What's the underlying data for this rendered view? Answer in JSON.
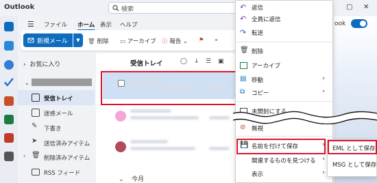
{
  "app": {
    "title": "Outlook"
  },
  "search": {
    "placeholder": "検索"
  },
  "ribbon": {
    "tabs": [
      "ファイル",
      "ホーム",
      "表示",
      "ヘルプ"
    ],
    "active_tab": "ホーム"
  },
  "toolbar": {
    "new_mail": "新規メール",
    "delete": "削除",
    "archive": "アーカイブ",
    "report": "報告"
  },
  "toggle": {
    "label": "ook"
  },
  "folders": {
    "favorites": "お気に入り",
    "items": [
      {
        "label": "受信トレイ",
        "icon": "inbox-icon",
        "selected": true
      },
      {
        "label": "迷惑メール",
        "icon": "junk-icon"
      },
      {
        "label": "下書き",
        "icon": "draft-icon"
      },
      {
        "label": "送信済みアイテム",
        "icon": "sent-icon"
      },
      {
        "label": "削除済みアイテム",
        "icon": "trash-icon"
      },
      {
        "label": "RSS フィード",
        "icon": "folder-icon"
      }
    ]
  },
  "maillist": {
    "title": "受信トレイ",
    "group_today": "今月"
  },
  "context_menu": {
    "items": [
      {
        "label": "返信",
        "icon": "reply-icon"
      },
      {
        "label": "全員に返信",
        "icon": "reply-all-icon"
      },
      {
        "label": "転送",
        "icon": "forward-icon"
      },
      {
        "label": "削除",
        "icon": "delete-icon"
      },
      {
        "label": "アーカイブ",
        "icon": "archive-icon"
      },
      {
        "label": "移動",
        "icon": "move-icon",
        "submenu": true
      },
      {
        "label": "コピー",
        "icon": "copy-icon",
        "submenu": true
      },
      {
        "label": "未開封にする",
        "icon": "unread-icon"
      },
      {
        "label": "無視",
        "icon": "ignore-icon"
      },
      {
        "label": "名前を付けて保存",
        "icon": "save-icon",
        "submenu": true
      },
      {
        "label": "関連するものを見つける",
        "icon": "",
        "submenu": true
      },
      {
        "label": "表示",
        "icon": "",
        "submenu": true
      }
    ]
  },
  "save_submenu": {
    "items": [
      "EML として保存",
      "MSG として保存"
    ]
  },
  "colors": {
    "accent": "#0f6cbd",
    "highlight": "#e0102a"
  }
}
